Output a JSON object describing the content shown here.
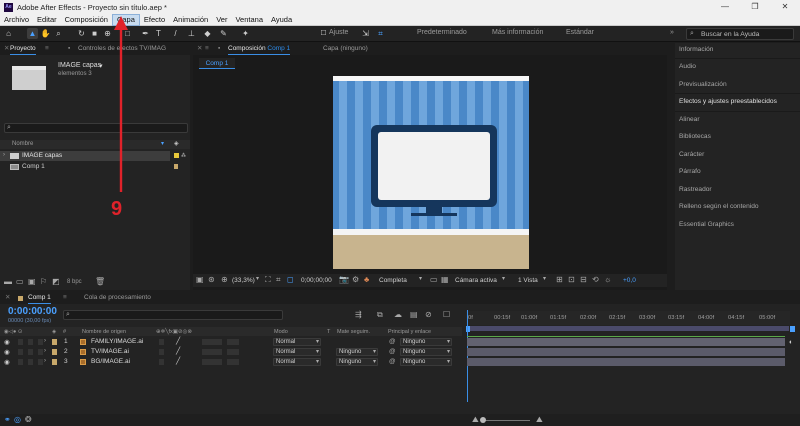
{
  "window": {
    "app_icon": "Ae",
    "title": "Adobe After Effects - Proyecto sin título.aep *",
    "minimize": "—",
    "maximize": "❐",
    "close": "✕"
  },
  "menu": [
    "Archivo",
    "Editar",
    "Composición",
    "Capa",
    "Efecto",
    "Animación",
    "Ver",
    "Ventana",
    "Ayuda"
  ],
  "toolbar": {
    "ajuste_label": "Ajuste",
    "workspaces": [
      "Predeterminado",
      "Más información",
      "Estándar"
    ],
    "more": "»",
    "search_placeholder": "Buscar en la Ayuda"
  },
  "project": {
    "tab_label": "Proyecto",
    "effects_tab_label": "Controles de efectos TV/IMAG",
    "item_name": "IMAGE capas",
    "item_sub": "elementos 3",
    "bpc": "8 bpc",
    "col_name": "Nombre",
    "items": [
      {
        "name": "IMAGE capas",
        "type": "folder",
        "selected": true
      },
      {
        "name": "Comp 1",
        "type": "comp",
        "selected": false
      }
    ]
  },
  "composition": {
    "tab_label": "Composición",
    "tab_comp": "Comp 1",
    "layer_tab": "Capa (ninguno)",
    "sub_tab": "Comp 1",
    "zoom": "(33,3%)",
    "timecode": "0;00;00;00",
    "resolution": "Completa",
    "camera": "Cámara activa",
    "views": "1 Vista",
    "offset": "+0,0"
  },
  "right_panel": {
    "items": [
      "Información",
      "Audio",
      "Previsualización",
      "Efectos y ajustes preestablecidos",
      "Alinear",
      "Bibliotecas",
      "Carácter",
      "Párrafo",
      "Rastreador",
      "Relleno según el contenido",
      "Essential Graphics"
    ]
  },
  "timeline": {
    "tab_label": "Comp 1",
    "render_tab": "Cola de procesamiento",
    "timecode": "0:00:00:00",
    "fps": "00000 (30,00 fps)",
    "headers": {
      "num": "#",
      "source": "Nombre de origen",
      "mode": "Modo",
      "t": "T",
      "matte": "Mate seguim.",
      "parent": "Principal y enlace"
    },
    "layers": [
      {
        "num": "1",
        "name": "FAMILY/IMAGE.ai",
        "mode": "Normal",
        "matte": "",
        "parent": "Ninguno",
        "color": "#c29c6c"
      },
      {
        "num": "2",
        "name": "TV/IMAGE.ai",
        "mode": "Normal",
        "matte": "Ninguno",
        "parent": "Ninguno",
        "color": "#c29c6c"
      },
      {
        "num": "3",
        "name": "BG/IMAGE.ai",
        "mode": "Normal",
        "matte": "Ninguno",
        "parent": "Ninguno",
        "color": "#c29c6c"
      }
    ],
    "ruler": [
      "0f",
      "00:15f",
      "01:00f",
      "01:15f",
      "02:00f",
      "02:15f",
      "03:00f",
      "03:15f",
      "04:00f",
      "04:15f",
      "05:00f"
    ]
  },
  "annotation": {
    "number": "9",
    "color": "#e0222a"
  }
}
